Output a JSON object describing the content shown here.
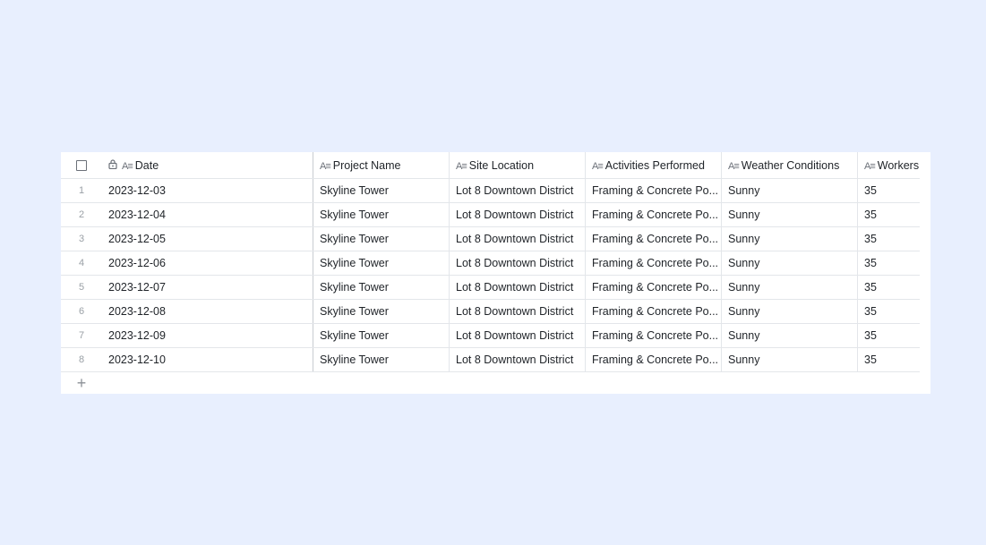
{
  "columns": {
    "date": "Date",
    "project": "Project Name",
    "site": "Site Location",
    "activities": "Activities Performed",
    "weather": "Weather Conditions",
    "workers": "Workers"
  },
  "type_icon": "A≡",
  "rows": [
    {
      "num": "1",
      "date": "2023-12-03",
      "project": "Skyline Tower",
      "site": "Lot 8 Downtown District",
      "activities": "Framing & Concrete Po...",
      "weather": "Sunny",
      "workers": "35"
    },
    {
      "num": "2",
      "date": "2023-12-04",
      "project": "Skyline Tower",
      "site": "Lot 8 Downtown District",
      "activities": "Framing & Concrete Po...",
      "weather": "Sunny",
      "workers": "35"
    },
    {
      "num": "3",
      "date": "2023-12-05",
      "project": "Skyline Tower",
      "site": "Lot 8 Downtown District",
      "activities": "Framing & Concrete Po...",
      "weather": "Sunny",
      "workers": "35"
    },
    {
      "num": "4",
      "date": "2023-12-06",
      "project": "Skyline Tower",
      "site": "Lot 8 Downtown District",
      "activities": "Framing & Concrete Po...",
      "weather": "Sunny",
      "workers": "35"
    },
    {
      "num": "5",
      "date": "2023-12-07",
      "project": "Skyline Tower",
      "site": "Lot 8 Downtown District",
      "activities": "Framing & Concrete Po...",
      "weather": "Sunny",
      "workers": "35"
    },
    {
      "num": "6",
      "date": "2023-12-08",
      "project": "Skyline Tower",
      "site": "Lot 8 Downtown District",
      "activities": "Framing & Concrete Po...",
      "weather": "Sunny",
      "workers": "35"
    },
    {
      "num": "7",
      "date": "2023-12-09",
      "project": "Skyline Tower",
      "site": "Lot 8 Downtown District",
      "activities": "Framing & Concrete Po...",
      "weather": "Sunny",
      "workers": "35"
    },
    {
      "num": "8",
      "date": "2023-12-10",
      "project": "Skyline Tower",
      "site": "Lot 8 Downtown District",
      "activities": "Framing & Concrete Po...",
      "weather": "Sunny",
      "workers": "35"
    }
  ],
  "add_row_label": "+"
}
